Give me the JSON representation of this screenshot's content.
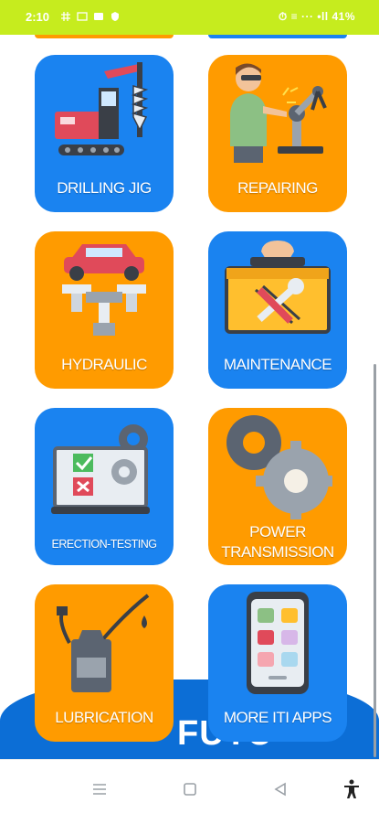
{
  "status_bar": {
    "time": "2:10",
    "right_text": "⏱ ≡ ··· •ll 41%"
  },
  "banner": {
    "text": "FUTU"
  },
  "tiles": [
    {
      "label": "DRILLING JIG",
      "color": "#1a83f0"
    },
    {
      "label": "REPAIRING",
      "color": "#ff9b00"
    },
    {
      "label": "HYDRAULIC",
      "color": "#ff9b00"
    },
    {
      "label": "MAINTENANCE",
      "color": "#1a83f0"
    },
    {
      "label": "ERECTION-TESTING",
      "color": "#1a83f0"
    },
    {
      "label_line1": "POWER",
      "label_line2": "TRANSMISSION",
      "color": "#ff9b00"
    },
    {
      "label": "LUBRICATION",
      "color": "#ff9b00"
    },
    {
      "label": "MORE ITI APPS",
      "color": "#1a83f0"
    }
  ],
  "navigation": {
    "recents_icon": "menu-lines-icon",
    "home_icon": "square-icon",
    "back_icon": "triangle-back-icon",
    "accessibility_icon": "accessibility-person-icon"
  },
  "colors": {
    "status_bar": "#c6ec1e",
    "blue_tile": "#1a83f0",
    "orange_tile": "#ff9b00",
    "banner": "#0c6ed6"
  }
}
